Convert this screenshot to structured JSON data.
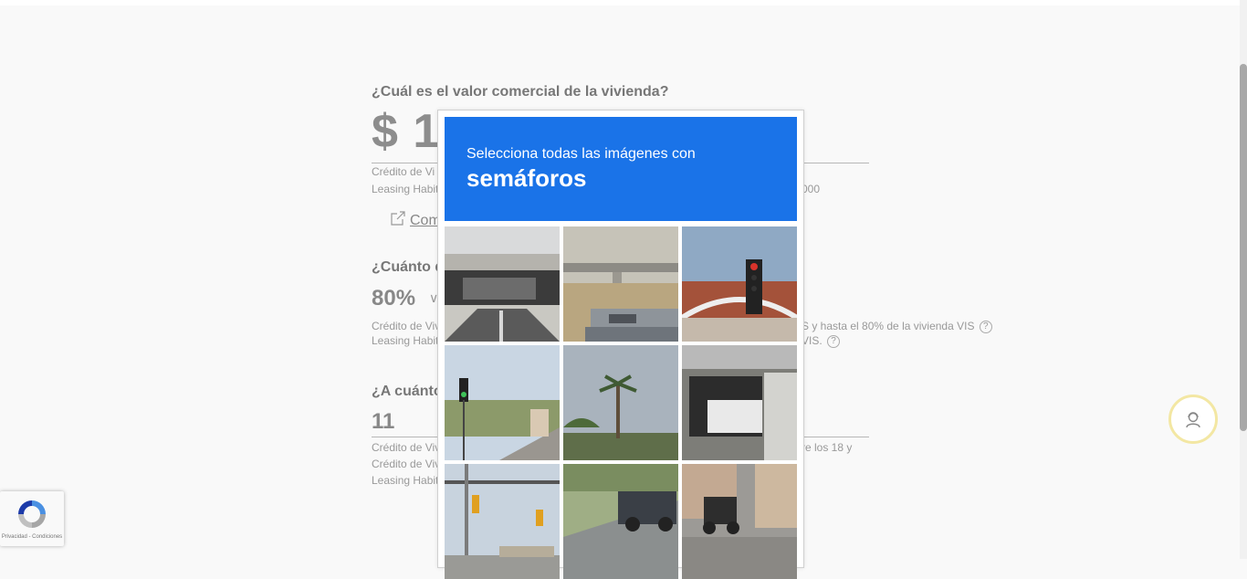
{
  "form": {
    "q1_title": "¿Cuál es el valor comercial de la vivienda?",
    "q1_value": "$ 1",
    "q1_note1": "Crédito de Vi",
    "q1_note2": "Leasing Habit",
    "q1_note2_right": "000",
    "ext_link": "Com",
    "q2_title": "¿Cuánto d",
    "q2_value": "80%",
    "q2_note1": "Crédito de Viv",
    "q2_note1_right": "S y hasta el 80% de la vivienda VIS",
    "q2_note2": "Leasing Habit",
    "q2_note2_right": "VIS.",
    "q3_title": "¿A cuánto",
    "q3_value": "11",
    "q3_note1": "Crédito de Viv",
    "q3_note1_right": "re los 18 y",
    "q3_note2": "Crédito de Viv",
    "q3_note3": "Leasing Habit"
  },
  "captcha": {
    "instruction": "Selecciona todas las imágenes con",
    "target": "semáforos",
    "tiles": [
      "highway-underpass",
      "overpass-pickup-truck",
      "traffic-light-building",
      "traffic-light-palm-street",
      "palm-tree",
      "garage-car",
      "intersection-traffic-lights",
      "parked-suv",
      "parked-scooter"
    ]
  },
  "recaptcha_badge": {
    "privacy_text": "Privacidad - Condiciones"
  },
  "icons": {
    "external_link": "external-link-icon",
    "help": "help-icon",
    "support": "support-agent-icon",
    "recaptcha": "recaptcha-logo-icon"
  },
  "colors": {
    "captcha_header": "#1a73e8",
    "support_ring": "#f3e7a3"
  }
}
